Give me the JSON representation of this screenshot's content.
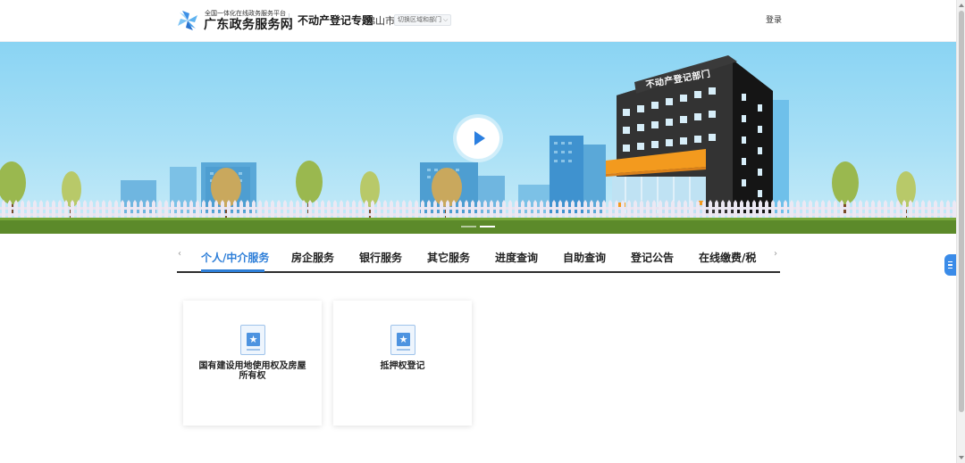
{
  "header": {
    "logo_subtitle": "全国一体化在线政务服务平台",
    "logo_title": "广东政务服务网",
    "topic_title": "不动产登记专题",
    "city": "佛山市",
    "region_switch_label": "切换区域和部门",
    "login_label": "登录"
  },
  "banner": {
    "building_sign": "不动产登记部门",
    "slides": 2,
    "active_slide": 2
  },
  "tabs": {
    "items": [
      {
        "label": "个人/中介服务",
        "active": true
      },
      {
        "label": "房企服务"
      },
      {
        "label": "银行服务"
      },
      {
        "label": "其它服务"
      },
      {
        "label": "进度查询"
      },
      {
        "label": "自助查询"
      },
      {
        "label": "登记公告"
      },
      {
        "label": "在线缴费/税"
      }
    ]
  },
  "cards": [
    {
      "title": "国有建设用地使用权及房屋所有权"
    },
    {
      "title": "抵押权登记"
    }
  ],
  "icons": {
    "logo": "windmill-logo-icon",
    "play": "play-icon",
    "prev": "chevron-left-icon",
    "next": "chevron-right-icon",
    "side": "menu-icon",
    "card": "certificate-icon"
  },
  "colors": {
    "accent": "#2d7ed8",
    "sky": "#8ad4f3",
    "building": "#2e2e2e",
    "awning": "#f39a1e"
  }
}
